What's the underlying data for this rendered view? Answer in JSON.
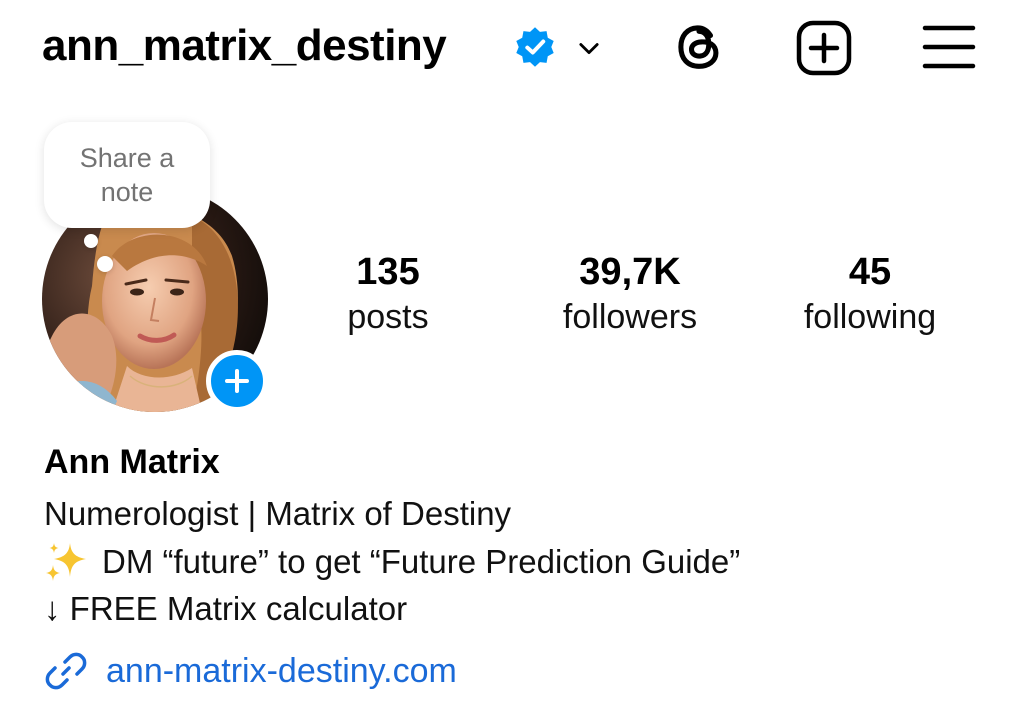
{
  "header": {
    "username": "ann_matrix_destiny",
    "icons": {
      "verified": "verified-badge-icon",
      "dropdown": "chevron-down-icon",
      "threads": "threads-icon",
      "create": "plus-square-icon",
      "menu": "hamburger-menu-icon"
    }
  },
  "note": {
    "text": "Share a note"
  },
  "stats": {
    "posts": {
      "value": "135",
      "label": "posts"
    },
    "followers": {
      "value": "39,7K",
      "label": "followers"
    },
    "following": {
      "value": "45",
      "label": "following"
    }
  },
  "profile": {
    "name": "Ann Matrix",
    "bio_line_1": "Numerologist | Matrix of Destiny",
    "bio_line_2": "DM “future” to get “Future Prediction Guide”",
    "bio_line_3": "↓ FREE Matrix calculator",
    "link": "ann-matrix-destiny.com"
  },
  "colors": {
    "accent_blue": "#0095f6",
    "link_blue": "#1a6ad8",
    "muted_text": "#737373"
  }
}
